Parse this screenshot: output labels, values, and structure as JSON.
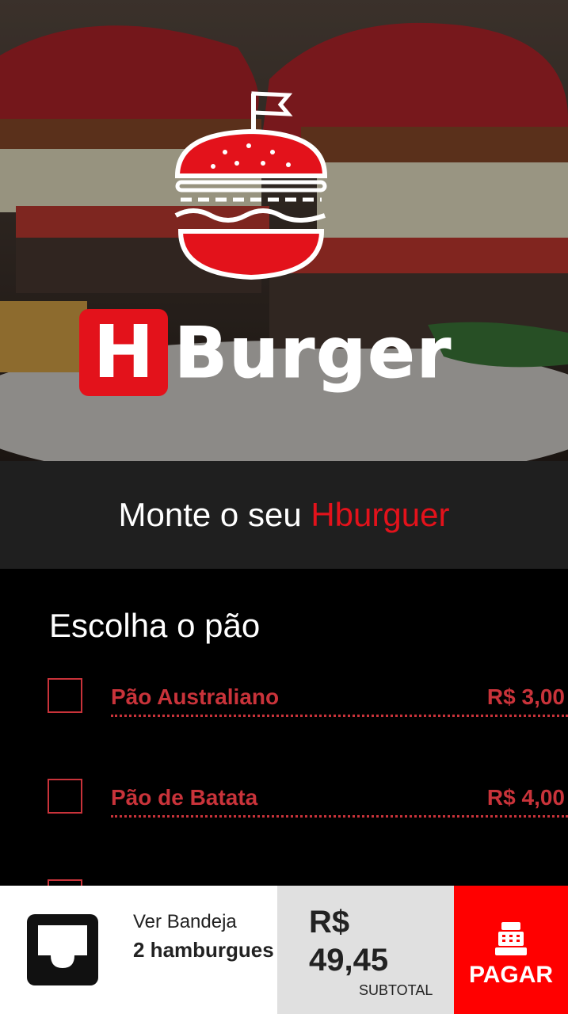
{
  "hero": {
    "logo_letter": "H",
    "logo_word": "Burger",
    "brand_color": "#e3121b"
  },
  "title": {
    "prefix": "Monte o seu ",
    "accent": "Hburguer"
  },
  "section": {
    "heading": "Escolha o pão",
    "options": [
      {
        "name": "Pão Australiano",
        "price": "R$ 3,00",
        "checked": false
      },
      {
        "name": "Pão de Batata",
        "price": "R$ 4,00",
        "checked": false
      }
    ]
  },
  "bottom_bar": {
    "tray_label": "Ver Bandeja",
    "tray_count": "2 hamburgues",
    "tray_icon": "tray-icon",
    "subtotal_amount": "R$ 49,45",
    "subtotal_label": "SUBTOTAL",
    "pay_label": "PAGAR",
    "pay_icon": "cash-register-icon"
  },
  "colors": {
    "accent": "#e3121b",
    "option_text": "#c9333a",
    "pay_bg": "#ff0000",
    "subtotal_bg": "#e0e0e0"
  }
}
